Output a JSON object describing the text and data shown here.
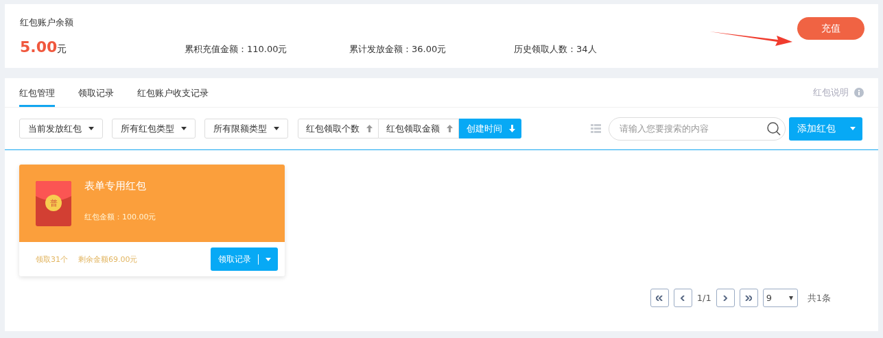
{
  "account": {
    "title": "红包账户余额",
    "balance": "5.00",
    "unit": "元",
    "stats": [
      "累积充值金额：110.00元",
      "累计发放金额：36.00元",
      "历史领取人数：34人"
    ],
    "recharge_button": "充值"
  },
  "tabs": [
    {
      "label": "红包管理",
      "selected": true
    },
    {
      "label": "领取记录",
      "selected": false
    },
    {
      "label": "红包账户收支记录",
      "selected": false
    }
  ],
  "help_link": "红包说明",
  "filters": [
    "当前发放红包",
    "所有红包类型",
    "所有限额类型"
  ],
  "sorts": [
    {
      "label": "红包领取个数",
      "selected": false,
      "descending": false
    },
    {
      "label": "红包领取金额",
      "selected": false,
      "descending": false
    },
    {
      "label": "创建时间",
      "selected": true,
      "descending": true
    }
  ],
  "search": {
    "placeholder": "请输入您要搜索的内容"
  },
  "add_button": "添加红包",
  "cards": [
    {
      "badge": "普",
      "title": "表单专用红包",
      "amount": "红包金额：100.00元",
      "claimed": "领取31个",
      "remaining": "剩余金额69.00元",
      "button": "领取记录"
    }
  ],
  "pagination": {
    "page": "1/1",
    "page_size": "9",
    "total": "共1条"
  }
}
